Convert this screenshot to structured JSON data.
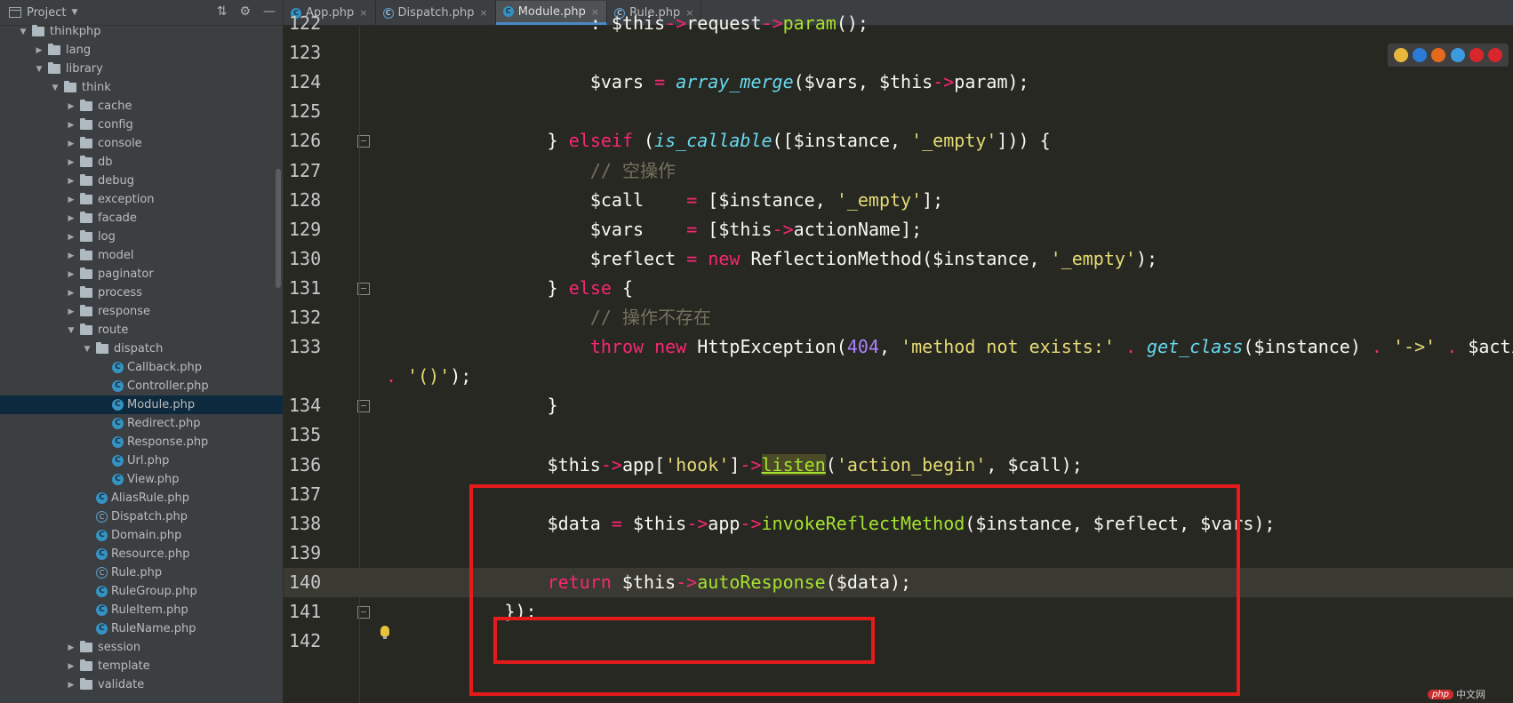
{
  "sidebar": {
    "title": "Project",
    "tree": [
      {
        "label": "thinkphp",
        "type": "folder",
        "depth": 0,
        "open": true
      },
      {
        "label": "lang",
        "type": "folder",
        "depth": 1,
        "open": false
      },
      {
        "label": "library",
        "type": "folder",
        "depth": 1,
        "open": true
      },
      {
        "label": "think",
        "type": "folder",
        "depth": 2,
        "open": true
      },
      {
        "label": "cache",
        "type": "folder",
        "depth": 3,
        "open": false
      },
      {
        "label": "config",
        "type": "folder",
        "depth": 3,
        "open": false
      },
      {
        "label": "console",
        "type": "folder",
        "depth": 3,
        "open": false
      },
      {
        "label": "db",
        "type": "folder",
        "depth": 3,
        "open": false
      },
      {
        "label": "debug",
        "type": "folder",
        "depth": 3,
        "open": false
      },
      {
        "label": "exception",
        "type": "folder",
        "depth": 3,
        "open": false
      },
      {
        "label": "facade",
        "type": "folder",
        "depth": 3,
        "open": false
      },
      {
        "label": "log",
        "type": "folder",
        "depth": 3,
        "open": false
      },
      {
        "label": "model",
        "type": "folder",
        "depth": 3,
        "open": false
      },
      {
        "label": "paginator",
        "type": "folder",
        "depth": 3,
        "open": false
      },
      {
        "label": "process",
        "type": "folder",
        "depth": 3,
        "open": false
      },
      {
        "label": "response",
        "type": "folder",
        "depth": 3,
        "open": false
      },
      {
        "label": "route",
        "type": "folder",
        "depth": 3,
        "open": true
      },
      {
        "label": "dispatch",
        "type": "folder",
        "depth": 4,
        "open": true
      },
      {
        "label": "Callback.php",
        "type": "class",
        "depth": 5
      },
      {
        "label": "Controller.php",
        "type": "class",
        "depth": 5
      },
      {
        "label": "Module.php",
        "type": "class",
        "depth": 5,
        "selected": true
      },
      {
        "label": "Redirect.php",
        "type": "class",
        "depth": 5
      },
      {
        "label": "Response.php",
        "type": "class",
        "depth": 5
      },
      {
        "label": "Url.php",
        "type": "class",
        "depth": 5
      },
      {
        "label": "View.php",
        "type": "class",
        "depth": 5
      },
      {
        "label": "AliasRule.php",
        "type": "class",
        "depth": 4
      },
      {
        "label": "Dispatch.php",
        "type": "abstract",
        "depth": 4
      },
      {
        "label": "Domain.php",
        "type": "class",
        "depth": 4
      },
      {
        "label": "Resource.php",
        "type": "class",
        "depth": 4
      },
      {
        "label": "Rule.php",
        "type": "abstract",
        "depth": 4
      },
      {
        "label": "RuleGroup.php",
        "type": "class",
        "depth": 4
      },
      {
        "label": "RuleItem.php",
        "type": "class",
        "depth": 4
      },
      {
        "label": "RuleName.php",
        "type": "class",
        "depth": 4
      },
      {
        "label": "session",
        "type": "folder",
        "depth": 3,
        "open": false
      },
      {
        "label": "template",
        "type": "folder",
        "depth": 3,
        "open": false
      },
      {
        "label": "validate",
        "type": "folder",
        "depth": 3,
        "open": false
      }
    ]
  },
  "tabs": [
    {
      "label": "App.php",
      "icon": "class",
      "active": false
    },
    {
      "label": "Dispatch.php",
      "icon": "abstract",
      "active": false
    },
    {
      "label": "Module.php",
      "icon": "class",
      "active": true
    },
    {
      "label": "Rule.php",
      "icon": "abstract",
      "active": false
    }
  ],
  "code": [
    {
      "n": "122",
      "indent": 17,
      "tokens": [
        [
          "var",
          ": $this"
        ],
        [
          "op",
          "->"
        ],
        [
          "var",
          "request"
        ],
        [
          "op",
          "->"
        ],
        [
          "m",
          "param"
        ],
        [
          "var",
          "();"
        ]
      ]
    },
    {
      "n": "123",
      "indent": 0,
      "tokens": []
    },
    {
      "n": "124",
      "indent": 17,
      "tokens": [
        [
          "var",
          "$vars "
        ],
        [
          "op",
          "="
        ],
        [
          "var",
          " "
        ],
        [
          "fn",
          "array_merge"
        ],
        [
          "var",
          "($vars, $this"
        ],
        [
          "op",
          "->"
        ],
        [
          "var",
          "param);"
        ]
      ]
    },
    {
      "n": "125",
      "indent": 0,
      "tokens": []
    },
    {
      "n": "126",
      "indent": 13,
      "fold": true,
      "tokens": [
        [
          "var",
          "} "
        ],
        [
          "kw",
          "elseif"
        ],
        [
          "var",
          " ("
        ],
        [
          "fn",
          "is_callable"
        ],
        [
          "var",
          "([$instance, "
        ],
        [
          "str",
          "'_empty'"
        ],
        [
          "var",
          "])) {"
        ]
      ]
    },
    {
      "n": "127",
      "indent": 17,
      "tokens": [
        [
          "cm",
          "// 空操作"
        ]
      ]
    },
    {
      "n": "128",
      "indent": 17,
      "tokens": [
        [
          "var",
          "$call    "
        ],
        [
          "op",
          "="
        ],
        [
          "var",
          " [$instance, "
        ],
        [
          "str",
          "'_empty'"
        ],
        [
          "var",
          "];"
        ]
      ]
    },
    {
      "n": "129",
      "indent": 17,
      "tokens": [
        [
          "var",
          "$vars    "
        ],
        [
          "op",
          "="
        ],
        [
          "var",
          " [$this"
        ],
        [
          "op",
          "->"
        ],
        [
          "var",
          "actionName];"
        ]
      ]
    },
    {
      "n": "130",
      "indent": 17,
      "tokens": [
        [
          "var",
          "$reflect "
        ],
        [
          "op",
          "="
        ],
        [
          "var",
          " "
        ],
        [
          "kw",
          "new"
        ],
        [
          "var",
          " ReflectionMethod($instance, "
        ],
        [
          "str",
          "'_empty'"
        ],
        [
          "var",
          ");"
        ]
      ]
    },
    {
      "n": "131",
      "indent": 13,
      "fold": true,
      "tokens": [
        [
          "var",
          "} "
        ],
        [
          "kw",
          "else"
        ],
        [
          "var",
          " {"
        ]
      ]
    },
    {
      "n": "132",
      "indent": 17,
      "tokens": [
        [
          "cm",
          "// 操作不存在"
        ]
      ]
    },
    {
      "n": "133",
      "indent": 17,
      "tokens": [
        [
          "kw",
          "throw"
        ],
        [
          "var",
          " "
        ],
        [
          "kw",
          "new"
        ],
        [
          "var",
          " HttpException("
        ],
        [
          "num",
          "404"
        ],
        [
          "var",
          ", "
        ],
        [
          "str",
          "'method not exists:'"
        ],
        [
          "var",
          " "
        ],
        [
          "op",
          "."
        ],
        [
          "var",
          " "
        ],
        [
          "fn",
          "get_class"
        ],
        [
          "var",
          "($instance) "
        ],
        [
          "op",
          "."
        ],
        [
          "var",
          " "
        ],
        [
          "str",
          "'->'"
        ],
        [
          "var",
          " "
        ],
        [
          "op",
          "."
        ],
        [
          "var",
          " $action"
        ]
      ]
    },
    {
      "n": "",
      "indent": 0,
      "wrap": true,
      "tokens": [
        [
          "op",
          "."
        ],
        [
          "var",
          " "
        ],
        [
          "str",
          "'()'"
        ],
        [
          "var",
          ");"
        ]
      ]
    },
    {
      "n": "134",
      "indent": 13,
      "fold": true,
      "tokens": [
        [
          "var",
          "}"
        ]
      ]
    },
    {
      "n": "135",
      "indent": 0,
      "tokens": []
    },
    {
      "n": "136",
      "indent": 13,
      "tokens": [
        [
          "var",
          "$this"
        ],
        [
          "op",
          "->"
        ],
        [
          "var",
          "app["
        ],
        [
          "str",
          "'hook'"
        ],
        [
          "var",
          "]"
        ],
        [
          "op",
          "->"
        ],
        [
          "mh",
          "listen"
        ],
        [
          "var",
          "("
        ],
        [
          "str",
          "'action_begin'"
        ],
        [
          "var",
          ", $call);"
        ]
      ]
    },
    {
      "n": "137",
      "indent": 0,
      "tokens": []
    },
    {
      "n": "138",
      "indent": 13,
      "tokens": [
        [
          "var",
          "$data "
        ],
        [
          "op",
          "="
        ],
        [
          "var",
          " $this"
        ],
        [
          "op",
          "->"
        ],
        [
          "var",
          "app"
        ],
        [
          "op",
          "->"
        ],
        [
          "m",
          "invokeReflectMethod"
        ],
        [
          "var",
          "($instance, $reflect, $vars);"
        ]
      ]
    },
    {
      "n": "139",
      "indent": 0,
      "tokens": []
    },
    {
      "n": "140",
      "indent": 13,
      "current": true,
      "tokens": [
        [
          "kw",
          "return"
        ],
        [
          "var",
          " $this"
        ],
        [
          "op",
          "->"
        ],
        [
          "m",
          "autoResponse"
        ],
        [
          "var",
          "($data);"
        ]
      ]
    },
    {
      "n": "141",
      "indent": 9,
      "fold": true,
      "tokens": [
        [
          "var",
          "});"
        ]
      ]
    },
    {
      "n": "142",
      "indent": 0,
      "tokens": []
    }
  ],
  "browsers": [
    {
      "name": "chrome-icon",
      "color": "#e8b83a"
    },
    {
      "name": "edge-icon",
      "color": "#2b7bd6"
    },
    {
      "name": "firefox-icon",
      "color": "#e66a1e"
    },
    {
      "name": "safari-icon",
      "color": "#3a9be0"
    },
    {
      "name": "opera-icon",
      "color": "#d8262c"
    },
    {
      "name": "opera-red-icon",
      "color": "#d8262c"
    }
  ],
  "watermark": {
    "logo": "php",
    "text": "中文网"
  }
}
